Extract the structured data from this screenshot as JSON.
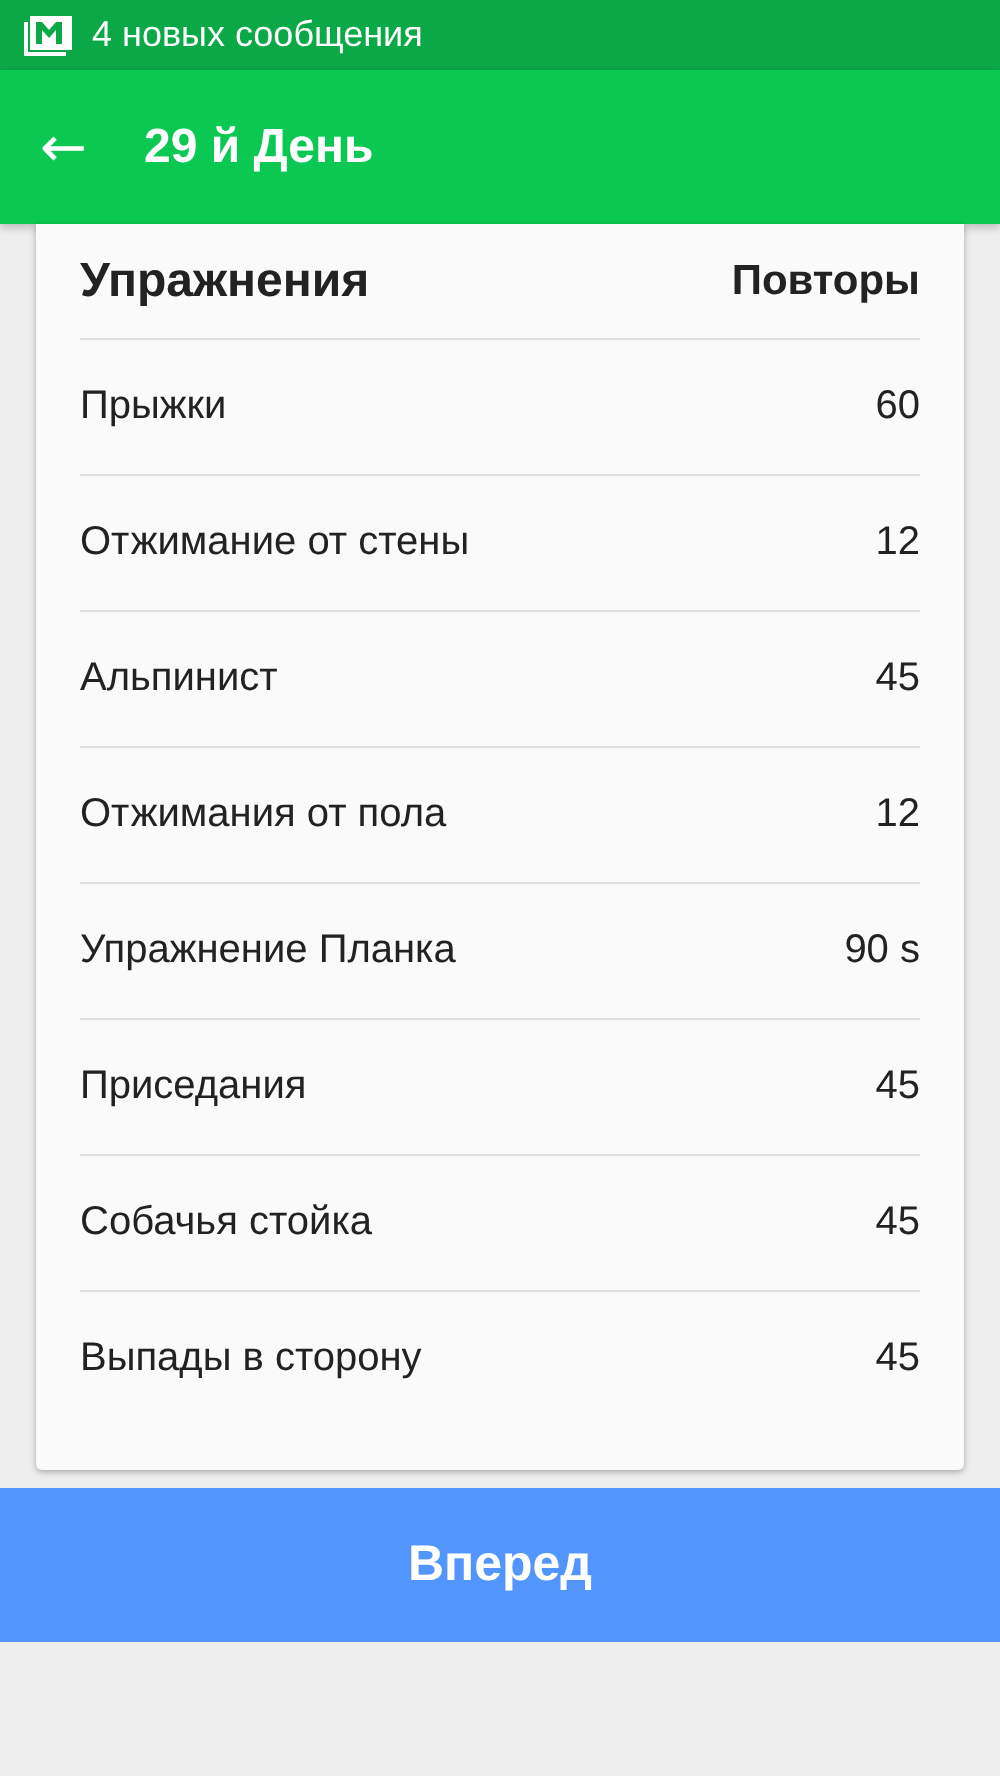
{
  "status_bar": {
    "notification": "4 новых сообщения"
  },
  "app_bar": {
    "back": "←",
    "title": "29 й День"
  },
  "table": {
    "columns": [
      "Упражнения",
      "Повторы"
    ],
    "rows": [
      {
        "exercise": "Прыжки",
        "reps": "60"
      },
      {
        "exercise": "Отжимание от стены",
        "reps": "12"
      },
      {
        "exercise": "Альпинист",
        "reps": "45"
      },
      {
        "exercise": "Отжимания от пола",
        "reps": "12"
      },
      {
        "exercise": "Упражнение Планка",
        "reps": "90 s"
      },
      {
        "exercise": "Приседания",
        "reps": "45"
      },
      {
        "exercise": "Собачья стойка",
        "reps": "45"
      },
      {
        "exercise": "Выпады в сторону",
        "reps": "45"
      }
    ]
  },
  "button": "Вперед"
}
